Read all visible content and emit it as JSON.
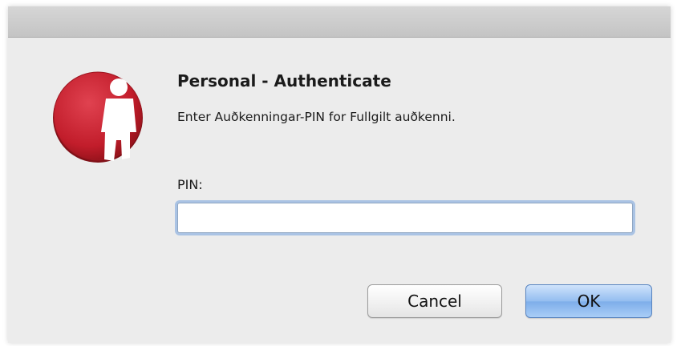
{
  "dialog": {
    "heading": "Personal - Authenticate",
    "message": "Enter Auðkenningar-PIN for Fullgilt auðkenni.",
    "app_icon": "person-red-circle-icon"
  },
  "pin": {
    "label": "PIN:",
    "value": "",
    "placeholder": ""
  },
  "buttons": {
    "cancel_label": "Cancel",
    "ok_label": "OK"
  },
  "colors": {
    "icon_red": "#c8202e",
    "ok_blue": "#94bdf0",
    "focus_ring": "#74a3de",
    "dialog_bg": "#ececec"
  }
}
